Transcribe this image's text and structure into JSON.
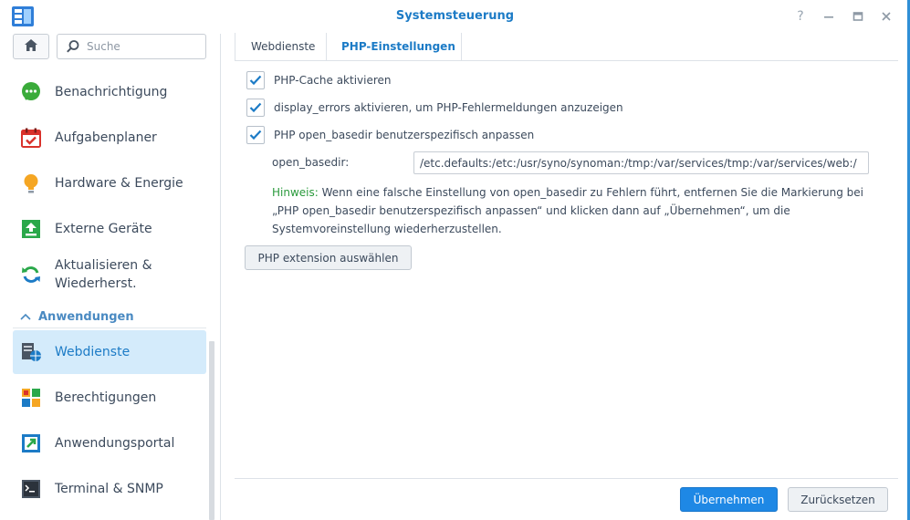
{
  "window": {
    "title": "Systemsteuerung",
    "controls": {
      "help": "?",
      "minimize": "—",
      "maximize": "□",
      "close": "✕"
    }
  },
  "sidebar": {
    "search_placeholder": "Suche",
    "items": [
      {
        "label": "Benachrichtigung",
        "icon": "chat-bubble-icon",
        "color": "#3aab3a"
      },
      {
        "label": "Aufgabenplaner",
        "icon": "calendar-check-icon",
        "color": "#d9322b"
      },
      {
        "label": "Hardware & Energie",
        "icon": "lightbulb-icon",
        "color": "#f5a623"
      },
      {
        "label": "Externe Geräte",
        "icon": "upload-arrow-icon",
        "color": "#2aa84a"
      },
      {
        "label": "Aktualisieren & Wiederherst.",
        "icon": "refresh-icon",
        "color": "#2aa84a"
      }
    ],
    "section": {
      "label": "Anwendungen",
      "icon": "chevron-up-icon"
    },
    "app_items": [
      {
        "label": "Webdienste",
        "icon": "web-services-icon",
        "active": true
      },
      {
        "label": "Berechtigungen",
        "icon": "permissions-icon",
        "active": false
      },
      {
        "label": "Anwendungsportal",
        "icon": "portal-arrow-icon",
        "active": false
      },
      {
        "label": "Terminal & SNMP",
        "icon": "terminal-icon",
        "active": false
      }
    ]
  },
  "tabs": [
    {
      "label": "Webdienste",
      "active": false
    },
    {
      "label": "PHP-Einstellungen",
      "active": true
    }
  ],
  "php": {
    "options": [
      {
        "label": "PHP-Cache aktivieren",
        "checked": true
      },
      {
        "label": "display_errors aktivieren, um PHP-Fehlermeldungen anzuzeigen",
        "checked": true
      },
      {
        "label": "PHP open_basedir benutzerspezifisch anpassen",
        "checked": true
      }
    ],
    "open_basedir_label": "open_basedir:",
    "open_basedir_value": "/etc.defaults:/etc:/usr/syno/synoman:/tmp:/var/services/tmp:/var/services/web:/",
    "hint_key": "Hinweis:",
    "hint_text": " Wenn eine falsche Einstellung von open_basedir zu Fehlern führt, entfernen Sie die Markierung bei „PHP open_basedir benutzerspezifisch anpassen“ und klicken dann auf „Übernehmen“, um die Systemvoreinstellung wiederherzustellen.",
    "extension_button": "PHP extension auswählen"
  },
  "footer": {
    "apply": "Übernehmen",
    "reset": "Zurücksetzen"
  },
  "colors": {
    "accent": "#1c7bc6",
    "primary_button": "#1e88e5",
    "active_item_bg": "#d4ebfb",
    "hint_green": "#2a9a3c"
  }
}
